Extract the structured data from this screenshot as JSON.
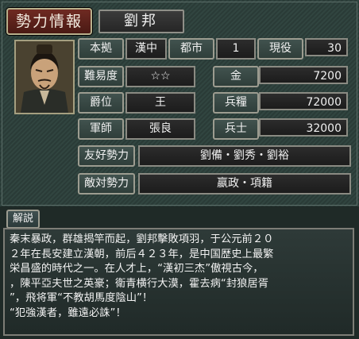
{
  "header": {
    "title": "勢力情報",
    "ruler": "劉邦"
  },
  "stats": {
    "base_label": "本拠",
    "base_value": "漢中",
    "cities_label": "都市",
    "cities_value": "1",
    "officers_label": "現役",
    "officers_value": "30",
    "difficulty_label": "難易度",
    "difficulty_value": "☆☆",
    "gold_label": "金",
    "gold_value": "7200",
    "rank_label": "爵位",
    "rank_value": "王",
    "food_label": "兵糧",
    "food_value": "72000",
    "strategist_label": "軍師",
    "strategist_value": "張良",
    "troops_label": "兵士",
    "troops_value": "32000",
    "friendly_label": "友好勢力",
    "friendly_value": "劉備・劉秀・劉裕",
    "hostile_label": "敵対勢力",
    "hostile_value": "嬴政・項籍"
  },
  "description": {
    "tab_label": "解説",
    "lines": [
      "秦末暴政，群雄揭竿而起，劉邦擊敗項羽，于公元前２０",
      "２年在長安建立漢朝，前后４２３年，是中国歴史上最繁",
      "栄昌盛的時代之一。在人才上，“漢初三杰”傲視古今，",
      "，陳平亞夫世之英豪；衛青横行大漠，霍去病“封狼居胥",
      "”，飛将軍“不教胡馬度陰山”！",
      "“犯強漢者，雖遠必誅”！"
    ]
  },
  "colors": {
    "title_bg": "#6f2a22",
    "panel_bg": "#2a3b37",
    "value_bg": "#1c1c1c"
  }
}
